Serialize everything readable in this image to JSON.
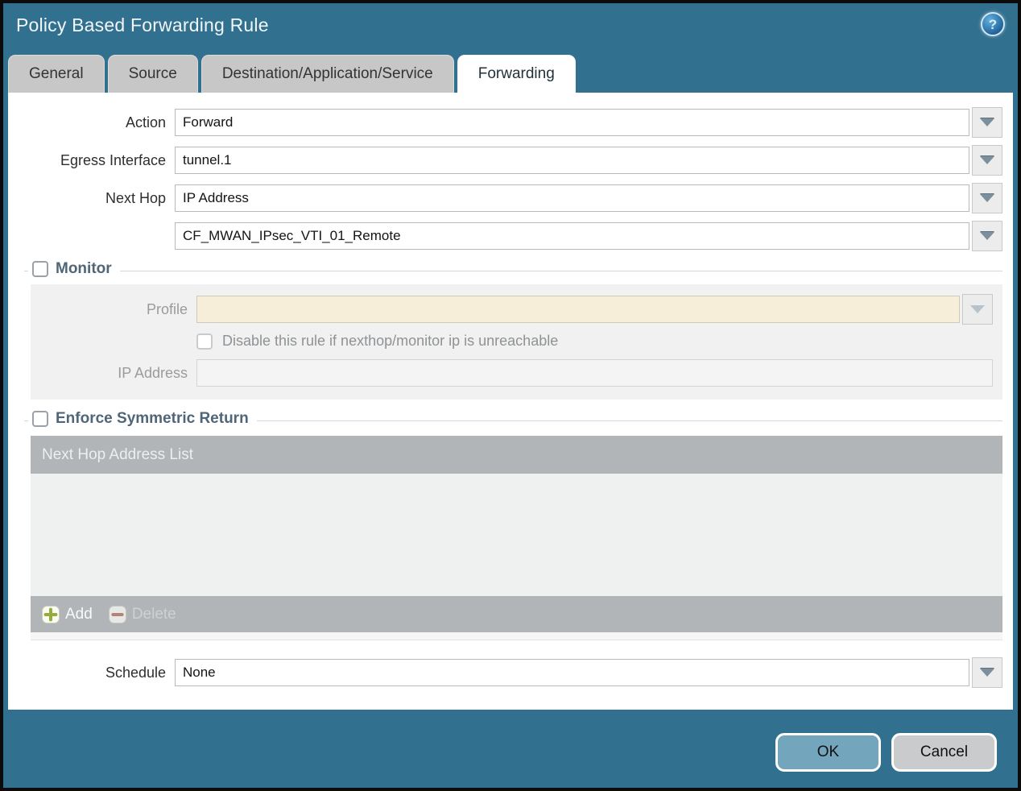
{
  "dialog": {
    "title": "Policy Based Forwarding Rule",
    "help_glyph": "?"
  },
  "tabs": [
    {
      "label": "General",
      "active": false
    },
    {
      "label": "Source",
      "active": false
    },
    {
      "label": "Destination/Application/Service",
      "active": false
    },
    {
      "label": "Forwarding",
      "active": true
    }
  ],
  "form": {
    "action": {
      "label": "Action",
      "value": "Forward"
    },
    "egress_interface": {
      "label": "Egress Interface",
      "value": "tunnel.1"
    },
    "next_hop": {
      "label": "Next Hop",
      "value": "IP Address"
    },
    "next_hop_address": {
      "value": "CF_MWAN_IPsec_VTI_01_Remote"
    },
    "schedule": {
      "label": "Schedule",
      "value": "None"
    }
  },
  "monitor": {
    "title": "Monitor",
    "checked": false,
    "profile": {
      "label": "Profile",
      "value": ""
    },
    "disable_rule": {
      "label": "Disable this rule if nexthop/monitor ip is unreachable",
      "checked": false
    },
    "ip_address": {
      "label": "IP Address",
      "value": ""
    }
  },
  "symmetric_return": {
    "title": "Enforce Symmetric Return",
    "checked": false,
    "table": {
      "header": "Next Hop Address List",
      "rows": []
    },
    "toolbar": {
      "add": "Add",
      "delete": "Delete"
    }
  },
  "footer": {
    "ok": "OK",
    "cancel": "Cancel"
  },
  "colors": {
    "header_teal": "#31708f",
    "active_tab_bg": "#ffffff",
    "inactive_tab_bg": "#c7c7c7",
    "section_title": "#4e6678",
    "table_header_bg": "#b1b5b8",
    "profile_field_bg": "#f7eed9",
    "ok_button_bg": "#73a6bd",
    "cancel_button_bg": "#c9cbcd",
    "add_plus_green": "#93ad3c",
    "delete_minus_red": "#a2624f"
  }
}
